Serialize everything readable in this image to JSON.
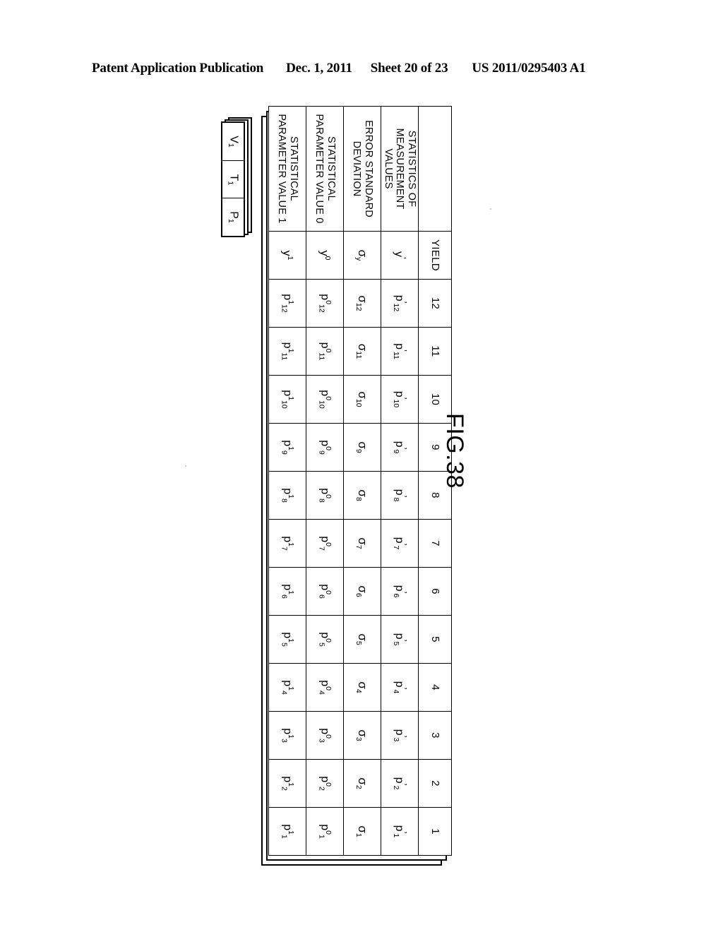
{
  "header": {
    "publication": "Patent Application Publication",
    "date": "Dec. 1, 2011",
    "sheet": "Sheet 20 of 23",
    "patent_number": "US 2011/0295403 A1"
  },
  "figure": {
    "caption": "FIG.38"
  },
  "tabs": {
    "items": [
      {
        "label": "V",
        "subscript": "1"
      },
      {
        "label": "T",
        "subscript": "1"
      },
      {
        "label": "P",
        "subscript": "1"
      }
    ]
  },
  "table": {
    "corner_label": "",
    "column_headers": [
      "YIELD",
      "12",
      "11",
      "10",
      "9",
      "8",
      "7",
      "6",
      "5",
      "4",
      "3",
      "2",
      "1"
    ],
    "rows": [
      {
        "label": "STATISTICS OF MEASUREMENT VALUES",
        "cells": [
          {
            "base": "y",
            "sub": "",
            "sup": "",
            "prime": true
          },
          {
            "base": "p",
            "sub": "12",
            "sup": "",
            "prime": true
          },
          {
            "base": "p",
            "sub": "11",
            "sup": "",
            "prime": true
          },
          {
            "base": "p",
            "sub": "10",
            "sup": "",
            "prime": true
          },
          {
            "base": "p",
            "sub": "9",
            "sup": "",
            "prime": true
          },
          {
            "base": "p",
            "sub": "8",
            "sup": "",
            "prime": true
          },
          {
            "base": "p",
            "sub": "7",
            "sup": "",
            "prime": true
          },
          {
            "base": "p",
            "sub": "6",
            "sup": "",
            "prime": true
          },
          {
            "base": "p",
            "sub": "5",
            "sup": "",
            "prime": true
          },
          {
            "base": "p",
            "sub": "4",
            "sup": "",
            "prime": true
          },
          {
            "base": "p",
            "sub": "3",
            "sup": "",
            "prime": true
          },
          {
            "base": "p",
            "sub": "2",
            "sup": "",
            "prime": true
          },
          {
            "base": "p",
            "sub": "1",
            "sup": "",
            "prime": true
          }
        ]
      },
      {
        "label": "ERROR STANDARD DEVIATION",
        "cells": [
          {
            "base": "σ",
            "sub": "y",
            "sup": "",
            "prime": false
          },
          {
            "base": "σ",
            "sub": "12",
            "sup": "",
            "prime": false
          },
          {
            "base": "σ",
            "sub": "11",
            "sup": "",
            "prime": false
          },
          {
            "base": "σ",
            "sub": "10",
            "sup": "",
            "prime": false
          },
          {
            "base": "σ",
            "sub": "9",
            "sup": "",
            "prime": false
          },
          {
            "base": "σ",
            "sub": "8",
            "sup": "",
            "prime": false
          },
          {
            "base": "σ",
            "sub": "7",
            "sup": "",
            "prime": false
          },
          {
            "base": "σ",
            "sub": "6",
            "sup": "",
            "prime": false
          },
          {
            "base": "σ",
            "sub": "5",
            "sup": "",
            "prime": false
          },
          {
            "base": "σ",
            "sub": "4",
            "sup": "",
            "prime": false
          },
          {
            "base": "σ",
            "sub": "3",
            "sup": "",
            "prime": false
          },
          {
            "base": "σ",
            "sub": "2",
            "sup": "",
            "prime": false
          },
          {
            "base": "σ",
            "sub": "1",
            "sup": "",
            "prime": false
          }
        ]
      },
      {
        "label": "STATISTICAL PARAMETER VALUE 0",
        "cells": [
          {
            "base": "y",
            "sub": "",
            "sup": "0",
            "prime": false
          },
          {
            "base": "p",
            "sub": "12",
            "sup": "0",
            "prime": false
          },
          {
            "base": "p",
            "sub": "11",
            "sup": "0",
            "prime": false
          },
          {
            "base": "p",
            "sub": "10",
            "sup": "0",
            "prime": false
          },
          {
            "base": "p",
            "sub": "9",
            "sup": "0",
            "prime": false
          },
          {
            "base": "p",
            "sub": "8",
            "sup": "0",
            "prime": false
          },
          {
            "base": "p",
            "sub": "7",
            "sup": "0",
            "prime": false
          },
          {
            "base": "p",
            "sub": "6",
            "sup": "0",
            "prime": false
          },
          {
            "base": "p",
            "sub": "5",
            "sup": "0",
            "prime": false
          },
          {
            "base": "p",
            "sub": "4",
            "sup": "0",
            "prime": false
          },
          {
            "base": "p",
            "sub": "3",
            "sup": "0",
            "prime": false
          },
          {
            "base": "p",
            "sub": "2",
            "sup": "0",
            "prime": false
          },
          {
            "base": "p",
            "sub": "1",
            "sup": "0",
            "prime": false
          }
        ]
      },
      {
        "label": "STATISTICAL PARAMETER VALUE 1",
        "cells": [
          {
            "base": "y",
            "sub": "",
            "sup": "1",
            "prime": false
          },
          {
            "base": "p",
            "sub": "12",
            "sup": "1",
            "prime": false
          },
          {
            "base": "p",
            "sub": "11",
            "sup": "1",
            "prime": false
          },
          {
            "base": "p",
            "sub": "10",
            "sup": "1",
            "prime": false
          },
          {
            "base": "p",
            "sub": "9",
            "sup": "1",
            "prime": false
          },
          {
            "base": "p",
            "sub": "8",
            "sup": "1",
            "prime": false
          },
          {
            "base": "p",
            "sub": "7",
            "sup": "1",
            "prime": false
          },
          {
            "base": "p",
            "sub": "6",
            "sup": "1",
            "prime": false
          },
          {
            "base": "p",
            "sub": "5",
            "sup": "1",
            "prime": false
          },
          {
            "base": "p",
            "sub": "4",
            "sup": "1",
            "prime": false
          },
          {
            "base": "p",
            "sub": "3",
            "sup": "1",
            "prime": false
          },
          {
            "base": "p",
            "sub": "2",
            "sup": "1",
            "prime": false
          },
          {
            "base": "p",
            "sub": "1",
            "sup": "1",
            "prime": false
          }
        ]
      }
    ]
  }
}
